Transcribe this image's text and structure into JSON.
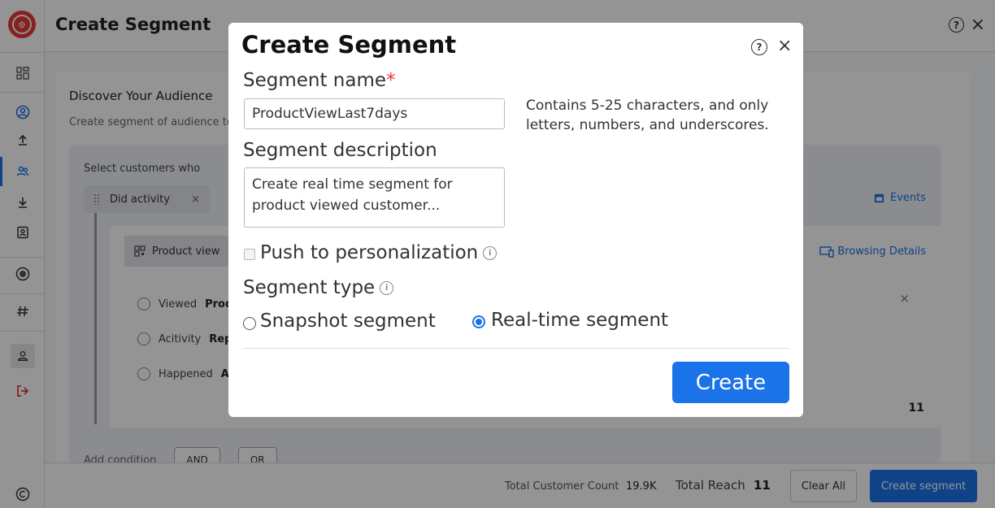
{
  "page": {
    "title": "Create Segment"
  },
  "card": {
    "title": "Discover Your Audience",
    "subtitle": "Create segment of audience to",
    "select_text": "Select customers who",
    "activity_chip": "Did activity",
    "events_link": "Events",
    "product_view_chip": "Product view",
    "browse_partial": "s",
    "browse_details": "Browsing Details",
    "conditions": [
      {
        "label": "Viewed",
        "value": "Produ"
      },
      {
        "label": "Acitivity",
        "value": "Repe"
      },
      {
        "label": "Happened",
        "value": "A"
      }
    ],
    "row_number": "11",
    "add_condition": "Add condition",
    "and_label": "AND",
    "or_label": "OR"
  },
  "footer": {
    "total_customer_label": "Total Customer Count",
    "total_customer_value": "19.9K",
    "total_reach_label": "Total Reach",
    "total_reach_value": "11",
    "clear_all": "Clear All",
    "create_segment": "Create segment"
  },
  "modal": {
    "title": "Create Segment",
    "segment_name_label": "Segment name",
    "required_mark": "*",
    "segment_name_value": "ProductViewLast7days",
    "segment_name_hint": "Contains 5-25 characters, and only letters, numbers, and underscores.",
    "segment_description_label": "Segment description",
    "segment_description_value": "Create real time segment for product viewed customer...",
    "push_label": "Push to personalization",
    "segment_type_label": "Segment type",
    "snapshot_label": "Snapshot segment",
    "realtime_label": "Real-time segment",
    "selected_type": "realtime",
    "create_label": "Create"
  },
  "colors": {
    "primary": "#1a73e8",
    "logo": "#e53935",
    "required": "#e53935"
  }
}
